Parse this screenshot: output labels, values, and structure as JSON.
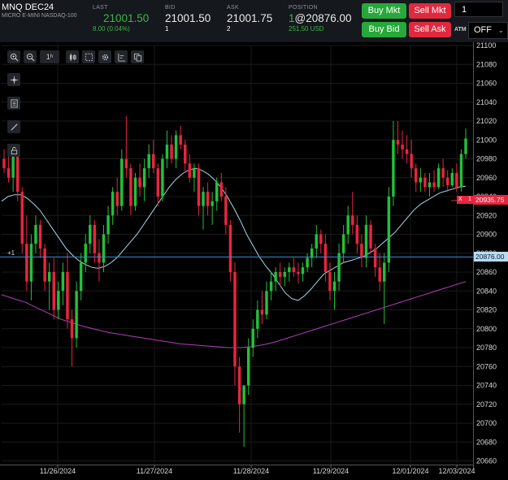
{
  "symbol": {
    "code": "MNQ DEC24",
    "desc": "MICRO E-MINI NASDAQ-100"
  },
  "quote": {
    "last_label": "LAST",
    "last_value": "21001.50",
    "change": "8.00 (0.04%)",
    "bid_label": "BID",
    "bid_value": "21001.50",
    "bid_size": "1",
    "ask_label": "ASK",
    "ask_value": "21001.75",
    "ask_size": "2",
    "position_label": "POSITION",
    "position_qty": "1",
    "position_price": "@20876.00",
    "position_pnl": "251.50 USD"
  },
  "buttons": {
    "buy_mkt": "Buy Mkt",
    "sell_mkt": "Sell Mkt",
    "buy_bid": "Buy Bid",
    "sell_ask": "Sell Ask"
  },
  "order": {
    "quantity": "1",
    "atm_label": "ATM",
    "atm_value": "OFF"
  },
  "toolbar": {
    "interval": "1ʰ"
  },
  "tags": {
    "position_marker": "+1",
    "order_x": "X",
    "order_qty": "1"
  },
  "price_tags": {
    "order": "20935.75",
    "position": "20876.00"
  },
  "colors": {
    "up": "#22c03a",
    "down": "#e8253f",
    "ma_fast": "#a8d8e8",
    "ma_slow": "#b43cbc",
    "position_line": "#3a8fd8",
    "order_tag": "#e8253f"
  },
  "chart_data": {
    "type": "candlestick",
    "ylim": [
      20660,
      21100
    ],
    "y_ticks": [
      21100,
      21080,
      21060,
      21040,
      21020,
      21000,
      20980,
      20960,
      20940,
      20920,
      20900,
      20880,
      20860,
      20840,
      20820,
      20800,
      20780,
      20760,
      20740,
      20720,
      20700,
      20680,
      20660
    ],
    "x_labels": [
      "11/26/2024",
      "11/27/2024",
      "11/28/2024",
      "11/29/2024",
      "12/01/2024",
      "12/03/2024"
    ],
    "position_price": 20876.0,
    "order_price": 20935.75,
    "candles": [
      [
        20980,
        20990,
        20965,
        20970
      ],
      [
        20970,
        20985,
        20955,
        20960
      ],
      [
        20960,
        20990,
        20945,
        20985
      ],
      [
        20985,
        20990,
        20935,
        20945
      ],
      [
        20945,
        20950,
        20880,
        20890
      ],
      [
        20890,
        20920,
        20840,
        20850
      ],
      [
        20850,
        20900,
        20830,
        20890
      ],
      [
        20890,
        20920,
        20880,
        20910
      ],
      [
        20910,
        20915,
        20875,
        20885
      ],
      [
        20885,
        20890,
        20840,
        20850
      ],
      [
        20850,
        20870,
        20820,
        20860
      ],
      [
        20860,
        20875,
        20810,
        20820
      ],
      [
        20820,
        20850,
        20810,
        20840
      ],
      [
        20840,
        20870,
        20825,
        20860
      ],
      [
        20860,
        20880,
        20800,
        20810
      ],
      [
        20810,
        20820,
        20760,
        20790
      ],
      [
        20790,
        20850,
        20780,
        20840
      ],
      [
        20840,
        20880,
        20830,
        20870
      ],
      [
        20870,
        20900,
        20860,
        20890
      ],
      [
        20890,
        20920,
        20880,
        20910
      ],
      [
        20910,
        20915,
        20870,
        20880
      ],
      [
        20880,
        20895,
        20850,
        20870
      ],
      [
        20870,
        20910,
        20860,
        20900
      ],
      [
        20900,
        20930,
        20890,
        20920
      ],
      [
        20920,
        20950,
        20910,
        20945
      ],
      [
        20945,
        20960,
        20920,
        20930
      ],
      [
        20930,
        20990,
        20925,
        20980
      ],
      [
        20980,
        21025,
        20960,
        20970
      ],
      [
        20970,
        20975,
        20920,
        20930
      ],
      [
        20930,
        20965,
        20925,
        20960
      ],
      [
        20960,
        20975,
        20940,
        20950
      ],
      [
        20950,
        20980,
        20935,
        20970
      ],
      [
        20970,
        20995,
        20960,
        20985
      ],
      [
        20985,
        21000,
        20965,
        20970
      ],
      [
        20970,
        20975,
        20930,
        20940
      ],
      [
        20940,
        20985,
        20935,
        20980
      ],
      [
        20980,
        21010,
        20970,
        20995
      ],
      [
        20995,
        21005,
        20975,
        20980
      ],
      [
        20980,
        21010,
        20970,
        21005
      ],
      [
        21005,
        21015,
        20990,
        20995
      ],
      [
        20995,
        21000,
        20965,
        20975
      ],
      [
        20975,
        20985,
        20955,
        20960
      ],
      [
        20960,
        20975,
        20945,
        20970
      ],
      [
        20970,
        20975,
        20920,
        20930
      ],
      [
        20930,
        20950,
        20905,
        20945
      ],
      [
        20945,
        20955,
        20920,
        20930
      ],
      [
        20930,
        20945,
        20910,
        20935
      ],
      [
        20935,
        20960,
        20925,
        20955
      ],
      [
        20955,
        20965,
        20935,
        20940
      ],
      [
        20940,
        20950,
        20900,
        20910
      ],
      [
        20910,
        20915,
        20850,
        20860
      ],
      [
        20860,
        20870,
        20740,
        20760
      ],
      [
        20760,
        20770,
        20690,
        20720
      ],
      [
        20720,
        20730,
        20675,
        20740
      ],
      [
        20740,
        20790,
        20730,
        20780
      ],
      [
        20780,
        20810,
        20770,
        20800
      ],
      [
        20800,
        20830,
        20790,
        20820
      ],
      [
        20820,
        20840,
        20805,
        20815
      ],
      [
        20815,
        20850,
        20810,
        20840
      ],
      [
        20840,
        20860,
        20830,
        20850
      ],
      [
        20850,
        20865,
        20840,
        20860
      ],
      [
        20860,
        20870,
        20845,
        20855
      ],
      [
        20855,
        20865,
        20845,
        20860
      ],
      [
        20860,
        20870,
        20850,
        20865
      ],
      [
        20865,
        20875,
        20855,
        20860
      ],
      [
        20860,
        20870,
        20848,
        20858
      ],
      [
        20858,
        20870,
        20850,
        20865
      ],
      [
        20865,
        20880,
        20860,
        20875
      ],
      [
        20875,
        20890,
        20865,
        20885
      ],
      [
        20885,
        20910,
        20875,
        20900
      ],
      [
        20900,
        20905,
        20880,
        20890
      ],
      [
        20890,
        20900,
        20850,
        20860
      ],
      [
        20860,
        20870,
        20830,
        20840
      ],
      [
        20840,
        20860,
        20820,
        20850
      ],
      [
        20850,
        20890,
        20840,
        20880
      ],
      [
        20880,
        20910,
        20870,
        20900
      ],
      [
        20900,
        20930,
        20890,
        20920
      ],
      [
        20920,
        20945,
        20900,
        20910
      ],
      [
        20910,
        20920,
        20880,
        20890
      ],
      [
        20890,
        20900,
        20865,
        20875
      ],
      [
        20875,
        20920,
        20865,
        20910
      ],
      [
        20910,
        20915,
        20880,
        20885
      ],
      [
        20885,
        20890,
        20855,
        20865
      ],
      [
        20865,
        20880,
        20840,
        20850
      ],
      [
        20850,
        20880,
        20805,
        20870
      ],
      [
        20870,
        20950,
        20860,
        20940
      ],
      [
        20940,
        21020,
        20930,
        21000
      ],
      [
        21000,
        21020,
        20985,
        20995
      ],
      [
        20995,
        21010,
        20980,
        20990
      ],
      [
        20990,
        21005,
        20975,
        20985
      ],
      [
        20985,
        21000,
        20960,
        20970
      ],
      [
        20970,
        20975,
        20945,
        20955
      ],
      [
        20955,
        20970,
        20945,
        20960
      ],
      [
        20960,
        20965,
        20945,
        20950
      ],
      [
        20950,
        20965,
        20940,
        20955
      ],
      [
        20955,
        20968,
        20945,
        20950
      ],
      [
        20950,
        20975,
        20948,
        20970
      ],
      [
        20970,
        20980,
        20950,
        20960
      ],
      [
        20960,
        20968,
        20945,
        20952
      ],
      [
        20952,
        20970,
        20950,
        20965
      ],
      [
        20965,
        20975,
        20945,
        20950
      ],
      [
        20950,
        20990,
        20945,
        20985
      ],
      [
        20985,
        21012,
        20980,
        21001.5
      ]
    ],
    "ma_fast": [
      20935,
      20940,
      20942,
      20942,
      20938,
      20932,
      20925,
      20915,
      20905,
      20895,
      20885,
      20878,
      20872,
      20868,
      20865,
      20864,
      20866,
      20870,
      20876,
      20884,
      20892,
      20900,
      20910,
      20920,
      20930,
      20940,
      20950,
      20958,
      20964,
      20968,
      20970,
      20968,
      20964,
      20958,
      20950,
      20940,
      20928,
      20915,
      20900,
      20888,
      20876,
      20866,
      20858,
      20848,
      20838,
      20832,
      20830,
      20835,
      20842,
      20850,
      20858,
      20862,
      20866,
      20870,
      20872,
      20874,
      20876,
      20880,
      20884,
      20890,
      20896,
      20902,
      20910,
      20918,
      20926,
      20932,
      20936,
      20940,
      20944,
      20946,
      20948,
      20950,
      20951
    ],
    "ma_slow": [
      20836,
      20832,
      20828,
      20822,
      20816,
      20810,
      20806,
      20802,
      20799,
      20796,
      20794,
      20792,
      20790,
      20788,
      20786,
      20784,
      20783,
      20782,
      20781,
      20780,
      20780,
      20781,
      20783,
      20786,
      20790,
      20794,
      20798,
      20802,
      20806,
      20810,
      20814,
      20818,
      20822,
      20826,
      20830,
      20834,
      20838,
      20842,
      20846,
      20850
    ]
  }
}
